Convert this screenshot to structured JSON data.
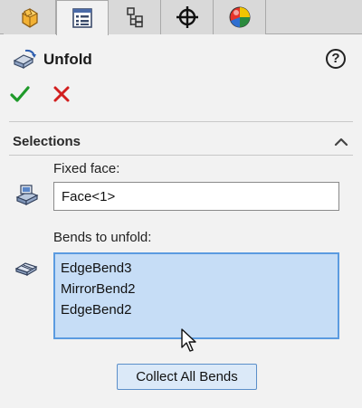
{
  "tabs": [
    {
      "icon": "part-icon",
      "active": false
    },
    {
      "icon": "property-manager-icon",
      "active": true
    },
    {
      "icon": "configuration-manager-icon",
      "active": false
    },
    {
      "icon": "dimxpert-icon",
      "active": false
    },
    {
      "icon": "display-manager-icon",
      "active": false
    }
  ],
  "header": {
    "title": "Unfold",
    "help_label": "?"
  },
  "actions": {
    "ok": "check-icon",
    "cancel": "close-icon"
  },
  "selections": {
    "title": "Selections",
    "fixed_face_label": "Fixed face:",
    "fixed_face_value": "Face<1>",
    "bends_label": "Bends to unfold:",
    "bends": [
      "EdgeBend3",
      "MirrorBend2",
      "EdgeBend2"
    ],
    "collect_button": "Collect All Bends"
  },
  "colors": {
    "accent": "#5b9be0",
    "list_bg": "#c6ddf6",
    "ok": "#1f9a2a",
    "cancel": "#d21f1f"
  }
}
